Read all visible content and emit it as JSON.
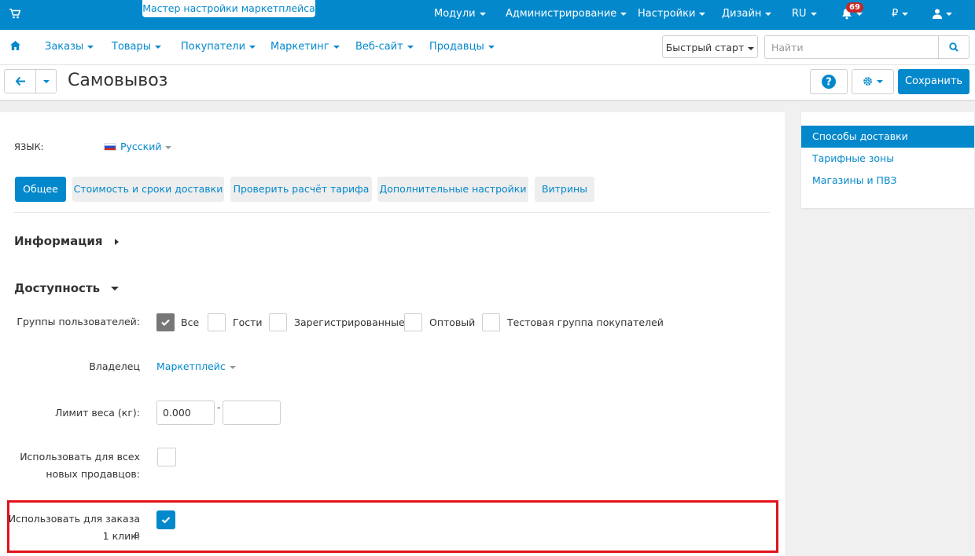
{
  "topbar": {
    "cart_icon": "cart-icon",
    "wizard_label": "Мастер настройки маркетплейса",
    "menus": [
      "Модули",
      "Администрирование",
      "Настройки",
      "Дизайн",
      "RU"
    ],
    "notifications_count": "69",
    "currency": "₽",
    "bell_icon": "bell-icon",
    "user_icon": "user-icon"
  },
  "nav": {
    "home_icon": "home-icon",
    "items": [
      "Заказы",
      "Товары",
      "Покупатели",
      "Маркетинг",
      "Веб-сайт",
      "Продавцы"
    ],
    "quick_start": "Быстрый старт",
    "search_placeholder": "Найти",
    "search_icon": "search-icon"
  },
  "titlebar": {
    "title": "Самовывоз",
    "save_label": "Сохранить",
    "help_icon": "help-icon",
    "gear_icon": "gear-icon",
    "back_icon": "arrow-left-icon"
  },
  "language": {
    "label": "ЯЗЫК:",
    "value": "Русский",
    "flag_icon": "russian-flag-icon"
  },
  "tabs": [
    "Общее",
    "Стоимость и сроки доставки",
    "Проверить расчёт тарифа",
    "Дополнительные настройки",
    "Витрины"
  ],
  "sections": {
    "info": "Информация",
    "availability": "Доступность"
  },
  "form": {
    "user_groups_label": "Группы пользователей:",
    "groups": [
      {
        "label": "Все",
        "checked": true
      },
      {
        "label": "Гости",
        "checked": false
      },
      {
        "label": "Зарегистрированные",
        "checked": false
      },
      {
        "label": "Оптовый",
        "checked": false
      },
      {
        "label": "Тестовая группа покупателей",
        "checked": false
      }
    ],
    "owner_label": "Владелец",
    "owner_value": "Маркетплейс",
    "weight_label": "Лимит веса (кг):",
    "weight_min": "0.000",
    "weight_max": "",
    "weight_separator": "-",
    "new_vendors_label_1": "Использовать для всех",
    "new_vendors_label_2": "новых продавцов:",
    "new_vendors_checked": false,
    "one_click_label_1": "Использовать для заказа в",
    "one_click_label_2": "1 клик:",
    "one_click_checked": true
  },
  "sidebar": {
    "items": [
      "Способы доставки",
      "Тарифные зоны",
      "Магазины и ПВЗ"
    ],
    "active_index": 0
  },
  "colors": {
    "brand": "#0388cc",
    "highlight": "#e0141b",
    "badge": "#c62828"
  }
}
